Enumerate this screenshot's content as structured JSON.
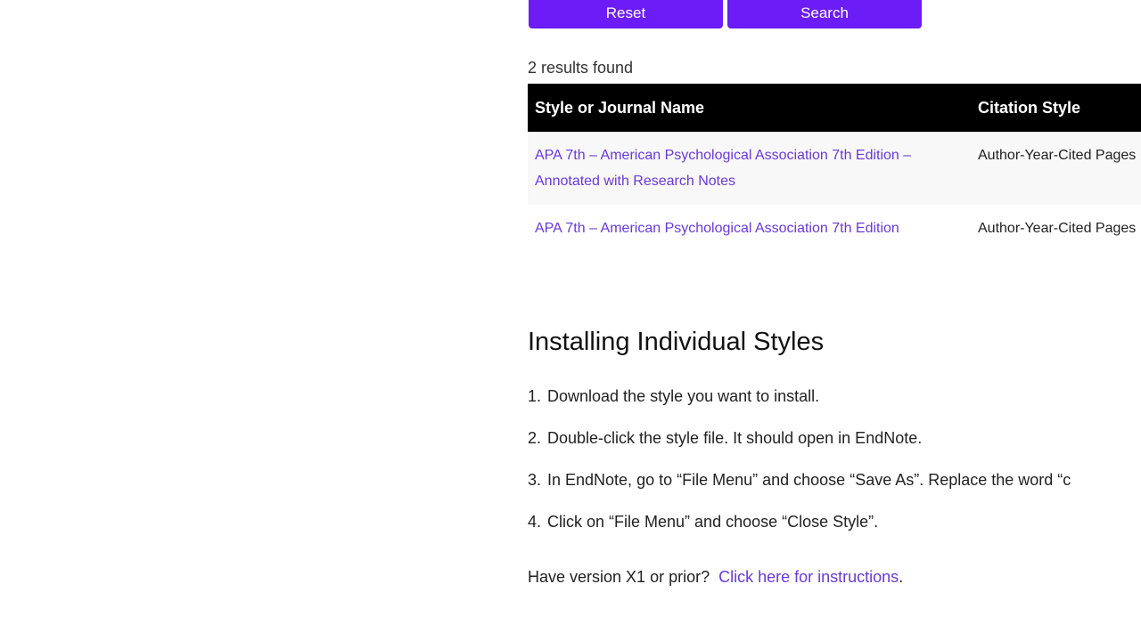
{
  "buttons": {
    "reset": "Reset",
    "search": "Search"
  },
  "results_count": "2 results found",
  "table": {
    "headers": [
      "Style or Journal Name",
      "Citation Style"
    ],
    "rows": [
      {
        "name": "APA 7th – American Psychological Association 7th Edition – Annotated with Research Notes",
        "style": "Author-Year-Cited Pages"
      },
      {
        "name": "APA 7th – American Psychological Association 7th Edition",
        "style": "Author-Year-Cited Pages"
      }
    ]
  },
  "install": {
    "heading": "Installing Individual Styles",
    "steps": [
      {
        "num": "1.",
        "text": "Download the style you want to install."
      },
      {
        "num": "2.",
        "text": "Double-click the style file.  It should open in EndNote."
      },
      {
        "num": "3.",
        "text": "In EndNote, go to “File Menu” and choose “Save As”.  Replace the word “c"
      },
      {
        "num": "4.",
        "text": "Click on “File Menu” and choose “Close Style”."
      }
    ],
    "note_text": "Have version X1 or prior?",
    "note_link": "Click here for instructions",
    "note_end": "."
  },
  "colors": {
    "button": "#6b1cf7",
    "link": "#6a3ad8",
    "header_bg": "#000000"
  }
}
